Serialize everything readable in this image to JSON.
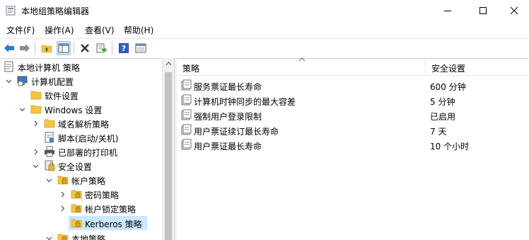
{
  "window": {
    "title": "本地组策略编辑器"
  },
  "menu": [
    "文件(F)",
    "操作(A)",
    "查看(V)",
    "帮助(H)"
  ],
  "toolbar": {
    "buttons": [
      "back-icon",
      "forward-icon",
      "up-folder-icon",
      "show-hide-tree-icon",
      "delete-icon",
      "export-list-icon",
      "help-icon",
      "properties-icon"
    ]
  },
  "tree": {
    "root": "本地计算机 策略",
    "computer_config": "计算机配置",
    "software_settings": "软件设置",
    "windows_settings": "Windows 设置",
    "name_resolution": "域名解析策略",
    "scripts": "脚本(启动/关机)",
    "printers": "已部署的打印机",
    "security_settings": "安全设置",
    "account_policies": "帐户策略",
    "password_policy": "密码策略",
    "lockout_policy": "帐户锁定策略",
    "kerberos_policy": "Kerberos 策略",
    "local_policies": "本地策略"
  },
  "list": {
    "columns": [
      "策略",
      "安全设置"
    ],
    "rows": [
      {
        "name": "服务票证最长寿命",
        "value": "600 分钟"
      },
      {
        "name": "计算机时钟同步的最大容差",
        "value": "5 分钟"
      },
      {
        "name": "强制用户登录限制",
        "value": "已启用"
      },
      {
        "name": "用户票证续订最长寿命",
        "value": "7 天"
      },
      {
        "name": "用户票证最长寿命",
        "value": "10 个小时"
      }
    ]
  },
  "colors": {
    "selection": "#cce8ff",
    "folder": "#f5c542",
    "accent": "#1e6fc9"
  }
}
